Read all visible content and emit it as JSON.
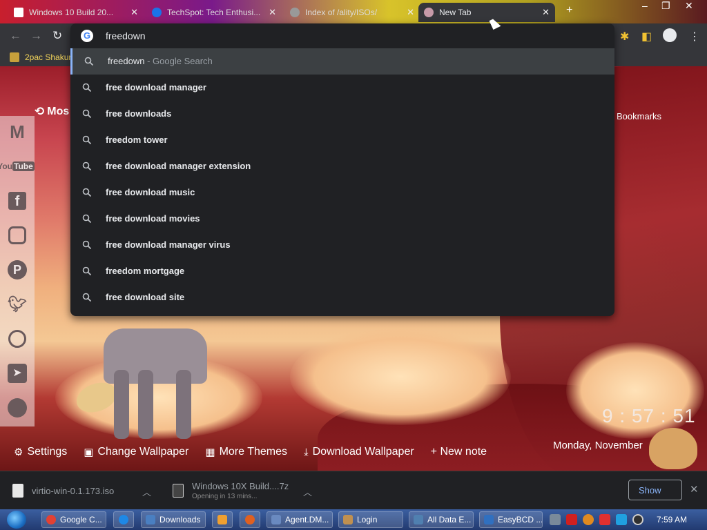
{
  "tabs": [
    {
      "label": "Windows 10 Build 20...",
      "active": false
    },
    {
      "label": "TechSpot: Tech Enthusi...",
      "active": false
    },
    {
      "label": "Index of /ality/ISOs/",
      "active": false
    },
    {
      "label": "New Tab",
      "active": true
    }
  ],
  "bookmarks_bar": {
    "item": "2pac Shakur"
  },
  "omnibox": {
    "input": "freedown",
    "suggestions": [
      {
        "text": "freedown",
        "sub": " - Google Search"
      },
      {
        "text": "free download manager",
        "sub": ""
      },
      {
        "text": "free downloads",
        "sub": ""
      },
      {
        "text": "freedom tower",
        "sub": ""
      },
      {
        "text": "free download manager extension",
        "sub": ""
      },
      {
        "text": "free download music",
        "sub": ""
      },
      {
        "text": "free download movies",
        "sub": ""
      },
      {
        "text": "free download manager virus",
        "sub": ""
      },
      {
        "text": "freedom mortgage",
        "sub": ""
      },
      {
        "text": "free download site",
        "sub": ""
      }
    ]
  },
  "page": {
    "most_visited": "Mos",
    "bookmarks": "Bookmarks",
    "clock": "9 : 57 : 51",
    "date": "Monday, November",
    "bottom_bar": {
      "settings": "Settings",
      "change_wallpaper": "Change Wallpaper",
      "more_themes": "More Themes",
      "download_wallpaper": "Download Wallpaper",
      "new_note": "+ New note"
    }
  },
  "social_icons": [
    "gmail-icon",
    "youtube-icon",
    "facebook-icon",
    "instagram-icon",
    "pinterest-icon",
    "twitter-icon",
    "whatsapp-icon",
    "telegram-icon",
    "reddit-icon"
  ],
  "downloads": [
    {
      "name": "virtio-win-0.1.173.iso",
      "status": ""
    },
    {
      "name": "Windows 10X Build....7z",
      "status": "Opening in 13 mins..."
    }
  ],
  "show_all": "Show",
  "taskbar": {
    "tasks": [
      {
        "label": "Google C...",
        "color": "#e34133"
      },
      {
        "label": "",
        "color": "#1e88e5"
      },
      {
        "label": "Downloads",
        "color": "#4a7fc1"
      },
      {
        "label": "",
        "color": "#f0a030"
      },
      {
        "label": "",
        "color": "#e06020"
      },
      {
        "label": "Agent.DM...",
        "color": "#6a8ac0"
      },
      {
        "label": "Login",
        "color": "#c09050"
      },
      {
        "label": "All Data E...",
        "color": "#5080b0"
      },
      {
        "label": "EasyBCD ...",
        "color": "#3070c0"
      }
    ],
    "time": "7:59 AM"
  },
  "colors": {
    "accent": "#8ab4f8",
    "omnibox_bg": "#202124",
    "toolbar_bg": "#35363a"
  }
}
